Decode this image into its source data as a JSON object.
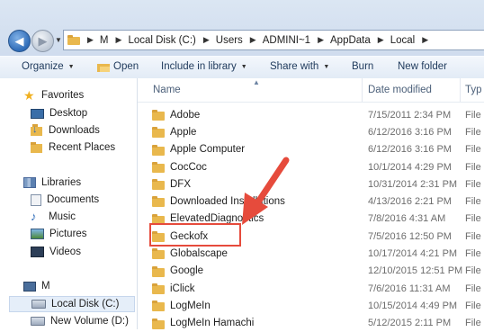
{
  "address_bar": {
    "crumbs": [
      "M",
      "Local Disk (C:)",
      "Users",
      "ADMINI~1",
      "AppData",
      "Local"
    ]
  },
  "toolbar": {
    "organize": "Organize",
    "open": "Open",
    "include_in_library": "Include in library",
    "share_with": "Share with",
    "burn": "Burn",
    "new_folder": "New folder"
  },
  "nav": {
    "favorites": "Favorites",
    "desktop": "Desktop",
    "downloads": "Downloads",
    "recent_places": "Recent Places",
    "libraries": "Libraries",
    "documents": "Documents",
    "music": "Music",
    "pictures": "Pictures",
    "videos": "Videos",
    "computer": "M",
    "local_disk": "Local Disk (C:)",
    "new_volume": "New Volume (D:)"
  },
  "columns": {
    "name": "Name",
    "date_modified": "Date modified",
    "type": "Typ"
  },
  "files": [
    {
      "name": "Adobe",
      "date": "7/15/2011 2:34 PM",
      "type": "File"
    },
    {
      "name": "Apple",
      "date": "6/12/2016 3:16 PM",
      "type": "File"
    },
    {
      "name": "Apple Computer",
      "date": "6/12/2016 3:16 PM",
      "type": "File"
    },
    {
      "name": "CocCoc",
      "date": "10/1/2014 4:29 PM",
      "type": "File"
    },
    {
      "name": "DFX",
      "date": "10/31/2014 2:31 PM",
      "type": "File"
    },
    {
      "name": "Downloaded Installations",
      "date": "4/13/2016 2:21 PM",
      "type": "File"
    },
    {
      "name": "ElevatedDiagnostics",
      "date": "7/8/2016 4:31 AM",
      "type": "File"
    },
    {
      "name": "Geckofx",
      "date": "7/5/2016 12:50 PM",
      "type": "File"
    },
    {
      "name": "Globalscape",
      "date": "10/17/2014 4:21 PM",
      "type": "File"
    },
    {
      "name": "Google",
      "date": "12/10/2015 12:51 PM",
      "type": "File"
    },
    {
      "name": "iClick",
      "date": "7/6/2016 11:31 AM",
      "type": "File"
    },
    {
      "name": "LogMeIn",
      "date": "10/15/2014 4:49 PM",
      "type": "File"
    },
    {
      "name": "LogMeIn Hamachi",
      "date": "5/12/2015 2:11 PM",
      "type": "File"
    }
  ],
  "annotation": {
    "highlighted_item": "Geckofx",
    "color": "#e64b3c"
  },
  "colors": {
    "toolbar_text": "#1e395b",
    "folder": "#e9b84d",
    "header_text": "#4c607a"
  }
}
